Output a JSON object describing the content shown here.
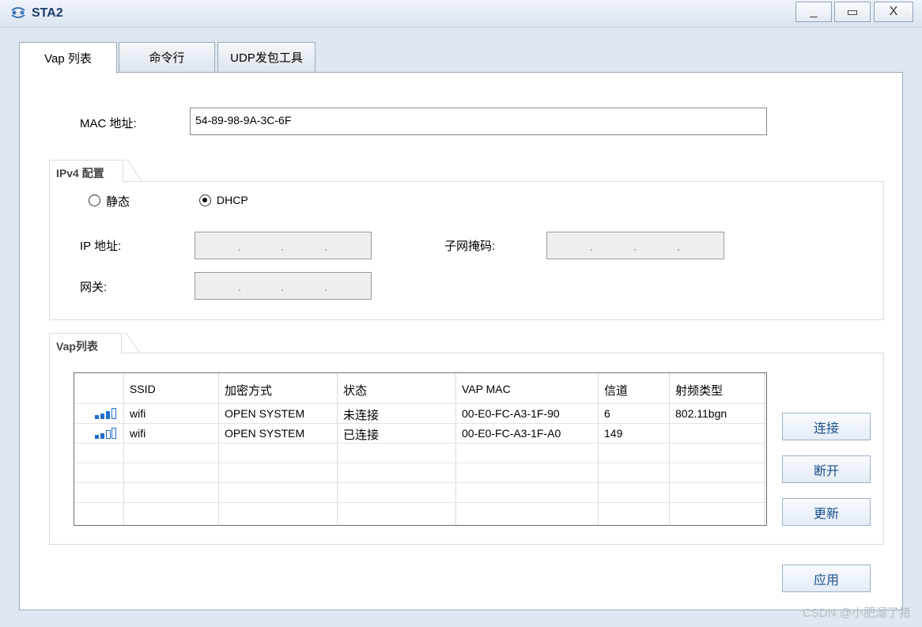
{
  "window": {
    "title": "STA2",
    "minimize": "_",
    "maximize": "▭",
    "close": "X",
    "icon": "network-icon"
  },
  "tabs": [
    {
      "label": "Vap 列表",
      "active": true
    },
    {
      "label": "命令行",
      "active": false
    },
    {
      "label": "UDP发包工具",
      "active": false
    }
  ],
  "mac": {
    "label": "MAC 地址:",
    "value": "54-89-98-9A-3C-6F"
  },
  "ipv4": {
    "group_title": "IPv4 配置",
    "static_label": "静态",
    "dhcp_label": "DHCP",
    "selected": "DHCP",
    "ip_label": "IP 地址:",
    "mask_label": "子网掩码:",
    "gateway_label": "网关:",
    "ip_value": ". . .",
    "mask_value": ". . .",
    "gateway_value": ". . ."
  },
  "vap": {
    "group_title": "Vap列表",
    "columns": [
      "SSID",
      "加密方式",
      "状态",
      "VAP MAC",
      "信道",
      "射频类型"
    ],
    "rows": [
      {
        "signal_bars": 3,
        "ssid": "wifi",
        "encryption": "OPEN SYSTEM",
        "status": "未连接",
        "mac": "00-E0-FC-A3-1F-90",
        "channel": "6",
        "radio": "802.11bgn"
      },
      {
        "signal_bars": 2,
        "ssid": "wifi",
        "encryption": "OPEN SYSTEM",
        "status": "已连接",
        "mac": "00-E0-FC-A3-1F-A0",
        "channel": "149",
        "radio": ""
      }
    ]
  },
  "buttons": {
    "connect": "连接",
    "disconnect": "断开",
    "refresh": "更新",
    "apply": "应用"
  },
  "watermark": "CSDN @小肥溜了猪",
  "colors": {
    "accent": "#1b4f8c",
    "signal": "#1f6fd1"
  }
}
